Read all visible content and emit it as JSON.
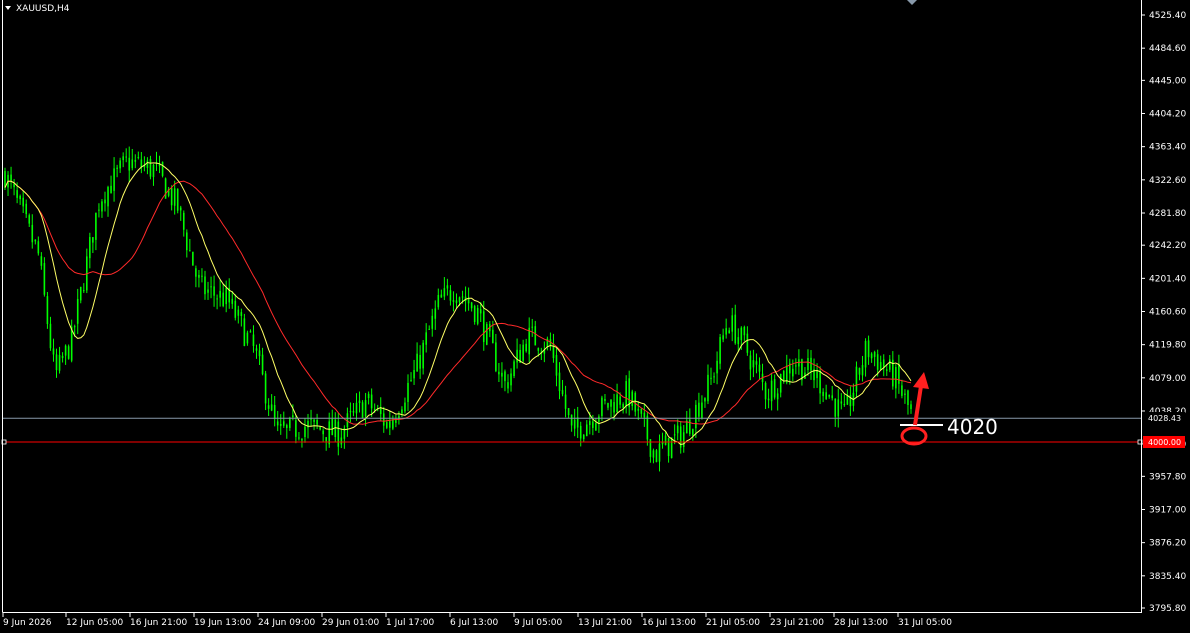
{
  "symbol_label": "XAUUSD,H4",
  "colors": {
    "background": "#000000",
    "frame": "#ffffff",
    "candle": "#00ff00",
    "ma_fast": "#ffff66",
    "ma_slow": "#ff2a2a",
    "support_line": "#ff0000",
    "bid_line": "#8899aa",
    "annotation": "#ff2020"
  },
  "chart_data": {
    "type": "candlestick",
    "instrument": "XAUUSD",
    "timeframe": "H4",
    "y_ticks": [
      "4525.40",
      "4484.60",
      "4445.00",
      "4404.20",
      "4363.40",
      "4322.60",
      "4281.80",
      "4242.20",
      "4201.40",
      "4160.60",
      "4119.80",
      "4079.00",
      "4038.20",
      "3997.60",
      "3957.80",
      "3917.00",
      "3876.20",
      "3835.40",
      "3795.80"
    ],
    "x_ticks": [
      "9 Jun 2026",
      "12 Jun 05:00",
      "16 Jun 21:00",
      "19 Jun 13:00",
      "24 Jun 09:00",
      "29 Jun 01:00",
      "1 Jul 17:00",
      "6 Jul 13:00",
      "9 Jul 05:00",
      "13 Jul 21:00",
      "16 Jul 13:00",
      "21 Jul 05:00",
      "23 Jul 21:00",
      "28 Jul 13:00",
      "31 Jul 05:00"
    ],
    "ylim": [
      3795.8,
      4525.4
    ],
    "price_path": [
      {
        "t": 0,
        "p": 4330
      },
      {
        "t": 0.03,
        "p": 4230
      },
      {
        "t": 0.045,
        "p": 4080
      },
      {
        "t": 0.06,
        "p": 4125
      },
      {
        "t": 0.085,
        "p": 4300
      },
      {
        "t": 0.11,
        "p": 4345
      },
      {
        "t": 0.135,
        "p": 4335
      },
      {
        "t": 0.155,
        "p": 4290
      },
      {
        "t": 0.175,
        "p": 4190
      },
      {
        "t": 0.2,
        "p": 4175
      },
      {
        "t": 0.225,
        "p": 4110
      },
      {
        "t": 0.245,
        "p": 4010
      },
      {
        "t": 0.27,
        "p": 4020
      },
      {
        "t": 0.3,
        "p": 4010
      },
      {
        "t": 0.325,
        "p": 4050
      },
      {
        "t": 0.345,
        "p": 4020
      },
      {
        "t": 0.37,
        "p": 4090
      },
      {
        "t": 0.39,
        "p": 4170
      },
      {
        "t": 0.405,
        "p": 4190
      },
      {
        "t": 0.425,
        "p": 4160
      },
      {
        "t": 0.45,
        "p": 4070
      },
      {
        "t": 0.47,
        "p": 4130
      },
      {
        "t": 0.49,
        "p": 4120
      },
      {
        "t": 0.51,
        "p": 4010
      },
      {
        "t": 0.535,
        "p": 4040
      },
      {
        "t": 0.56,
        "p": 4060
      },
      {
        "t": 0.585,
        "p": 3985
      },
      {
        "t": 0.61,
        "p": 4010
      },
      {
        "t": 0.635,
        "p": 4075
      },
      {
        "t": 0.65,
        "p": 4150
      },
      {
        "t": 0.665,
        "p": 4120
      },
      {
        "t": 0.685,
        "p": 4060
      },
      {
        "t": 0.71,
        "p": 4100
      },
      {
        "t": 0.73,
        "p": 4080
      },
      {
        "t": 0.755,
        "p": 4030
      },
      {
        "t": 0.775,
        "p": 4115
      },
      {
        "t": 0.8,
        "p": 4080
      },
      {
        "t": 0.815,
        "p": 4035
      }
    ],
    "current_price": "4028.43",
    "support_level": "4000.00",
    "annotation_label": "4020"
  }
}
